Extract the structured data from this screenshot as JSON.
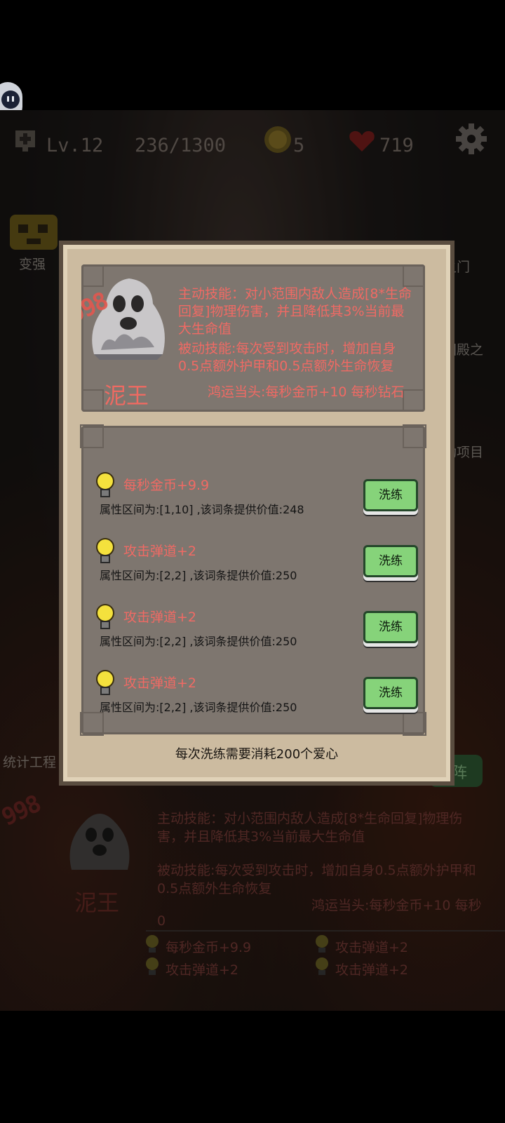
{
  "hud": {
    "level": "Lv.12",
    "exp": "236/1300",
    "coins": "5",
    "hearts": "719"
  },
  "side": {
    "left_top": "变强",
    "right_1": "之门",
    "right_2": "回殿之",
    "right_3": "动项目",
    "left_bottom": "统计工程",
    "right_bottom": "上阵"
  },
  "modal": {
    "level_stamp": "998",
    "monster_name": "泥王",
    "active_skill": "主动技能：对小范围内敌人造成[8*生命回复]物理伤害，并且降低其3%当前最大生命值",
    "passive_skill": "被动技能:每次受到攻击时，增加自身0.5点额外护甲和0.5点额外生命恢复",
    "lucky_line": "鸿运当头:每秒金币+10 每秒钻石",
    "attributes": [
      {
        "title": "每秒金币+9.9",
        "desc": "属性区间为:[1,10] ,该词条提供价值:248",
        "button": "洗练"
      },
      {
        "title": "攻击弹道+2",
        "desc": "属性区间为:[2,2] ,该词条提供价值:250",
        "button": "洗练"
      },
      {
        "title": "攻击弹道+2",
        "desc": "属性区间为:[2,2] ,该词条提供价值:250",
        "button": "洗练"
      },
      {
        "title": "攻击弹道+2",
        "desc": "属性区间为:[2,2] ,该词条提供价值:250",
        "button": "洗练"
      }
    ],
    "cost_note": "每次洗练需要消耗200个爱心"
  },
  "background": {
    "level_stamp": "998",
    "monster_name": "泥王",
    "active_skill": "主动技能：对小范围内敌人造成[8*生命回复]物理伤害，并且降低其3%当前最大生命值",
    "passive_skill": "被动技能:每次受到攻击时，增加自身0.5点额外护甲和0.5点额外生命恢复",
    "lucky_line": "鸿运当头:每秒金币+10 每秒",
    "lucky_tail": "0",
    "attrs": [
      "每秒金币+9.9",
      "攻击弹道+2",
      "攻击弹道+2",
      "攻击弹道+2"
    ]
  },
  "colors": {
    "accent_red": "#f06a64",
    "button_green": "#86d37a",
    "panel": "#7e766f",
    "frame": "#ccbba0"
  }
}
